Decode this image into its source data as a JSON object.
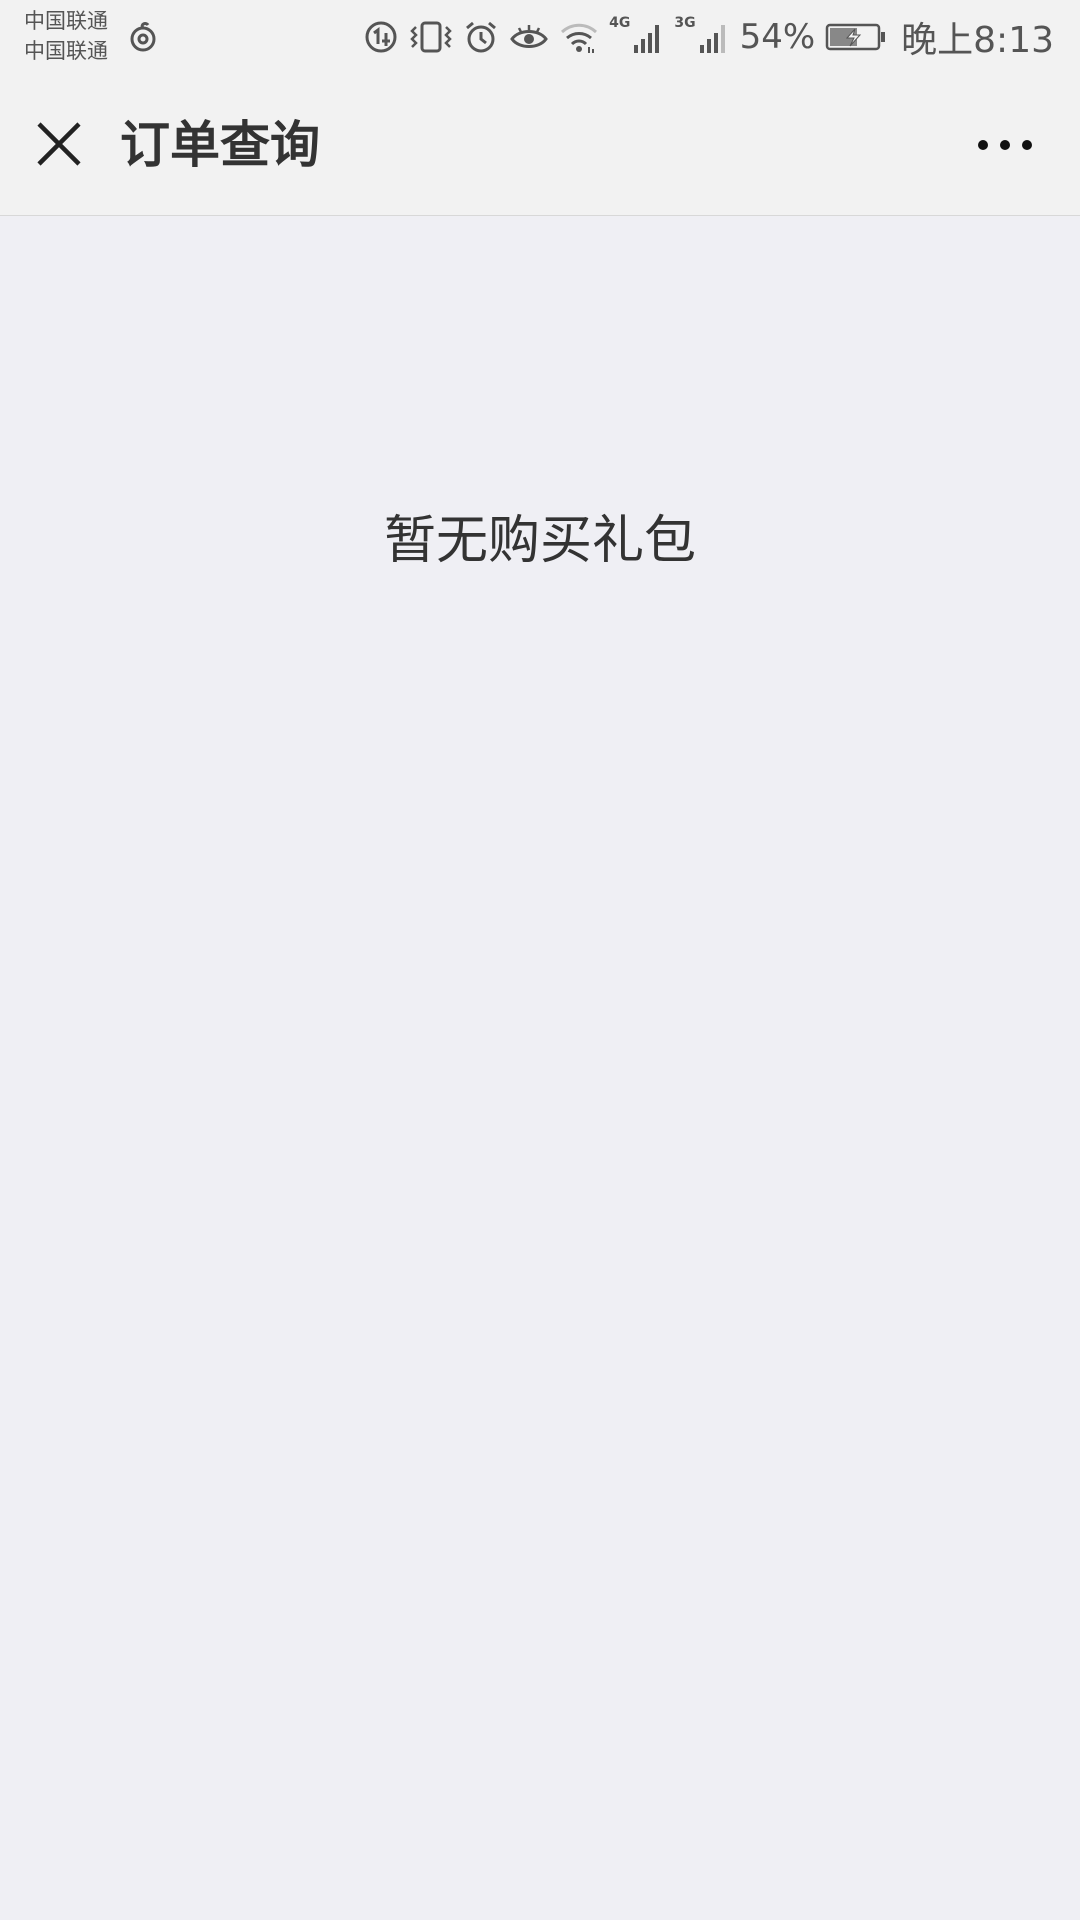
{
  "status_bar": {
    "carrier_1": "中国联通",
    "carrier_2": "中国联通",
    "network_1": "4G",
    "network_2": "3G",
    "battery_percent": "54%",
    "time": "晚上8:13",
    "icons": [
      "netease-cloud-music-icon",
      "data-saver-icon",
      "vibrate-icon",
      "alarm-icon",
      "eye-comfort-icon",
      "wifi-icon",
      "signal-icon",
      "signal-icon",
      "battery-charging-icon"
    ]
  },
  "nav": {
    "title": "订单查询",
    "close_icon": "close-icon",
    "more_icon": "more-icon"
  },
  "content": {
    "empty_message": "暂无购买礼包"
  }
}
